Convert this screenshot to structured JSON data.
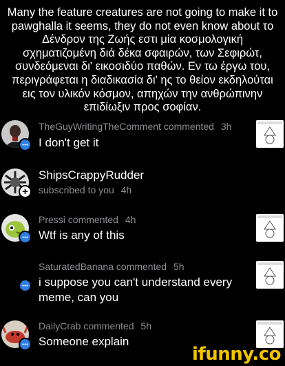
{
  "caption": "Many the feature creatures are not going to make it to pawghalla it seems, they do not even know about το Δένδρον της Ζωής εστι μία κοσμολογική σχηματιζομένη διά δέκα σφαιρών, των Σεφιρώτ, συνδεόμεναι δι' εικοσιδύο παθών. Εν τω έργω του, περιγράφεται η διαδικασία δι' ης το θείον εκδηλούται εις τον υλικόν κόσμον, απηχών την ανθρώπινην επιδίωξιν προς σοφίαν.",
  "notifications": [
    {
      "user": "TheGuyWritingTheComment",
      "action": "commented",
      "time": "3h",
      "text": "I don't get it",
      "badge": "chat-icon"
    },
    {
      "user": "ShipsCrappyRudder",
      "action": "subscribed to you",
      "time": "4h",
      "badge": "plus-icon"
    },
    {
      "user": "Pressi",
      "action": "commented",
      "time": "4h",
      "text": "Wtf is any of this",
      "badge": "chat-icon"
    },
    {
      "user": "SaturatedBanana",
      "action": "commented",
      "time": "5h",
      "text": "i suppose you can't understand every meme, can you",
      "badge": "chat-icon"
    },
    {
      "user": "DailyCrab",
      "action": "commented",
      "time": "5h",
      "text": "Someone explain",
      "badge": "chat-icon"
    }
  ],
  "badge_plus": "+",
  "watermark": "ifunny.co",
  "colors": {
    "background": "#000000",
    "meta": "#8e8e93",
    "chat_badge": "#2f7de1",
    "watermark": "#f2c400"
  }
}
